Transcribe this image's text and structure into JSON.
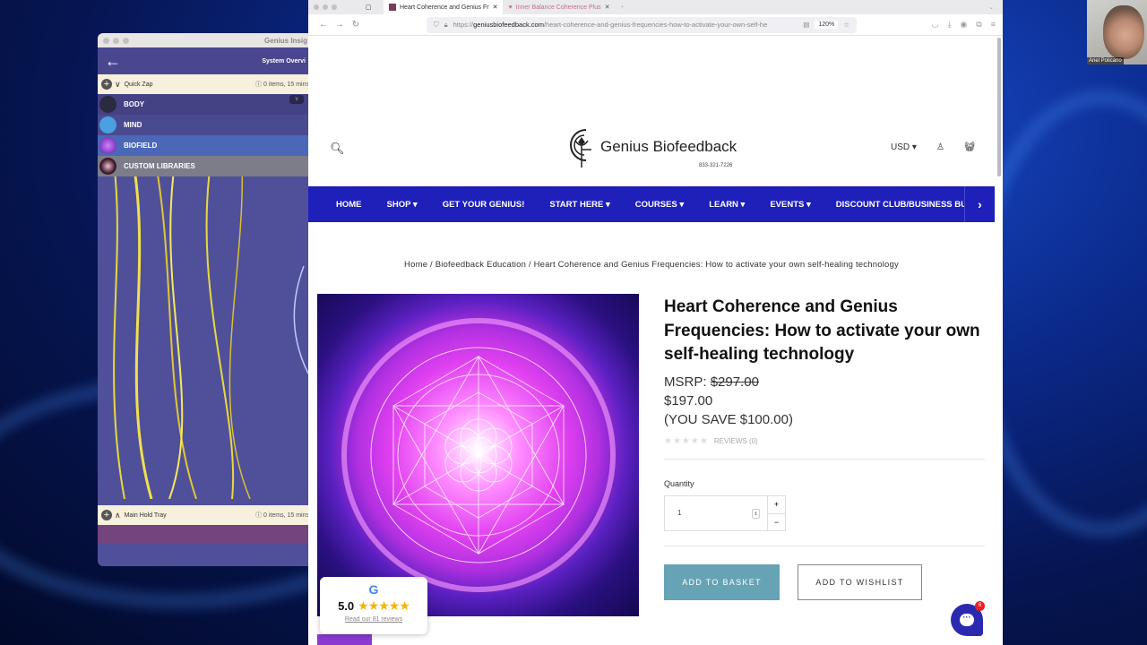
{
  "desktop": {
    "theme_colors": {
      "background": "#0b2a8c"
    }
  },
  "left_app": {
    "window_title": "Genius Insig",
    "back_icon": "back-arrow-icon",
    "header_label": "System Overvi",
    "quick_zap": {
      "label": "Quick Zap",
      "info": "0 items, 15 mins"
    },
    "libraries": [
      {
        "label": "BODY",
        "icon_color": "#2a2a40"
      },
      {
        "label": "MIND",
        "icon_color": "#4aa0e0"
      },
      {
        "label": "BIOFIELD",
        "icon_color": "#7a30c0"
      },
      {
        "label": "CUSTOM LIBRARIES",
        "icon_color": "#3a1a2a"
      }
    ],
    "main_hold_tray": {
      "label": "Main Hold Tray",
      "info": "0 items, 15 mins"
    }
  },
  "browser": {
    "tabs": [
      {
        "title": "Heart Coherence and Genius Fr",
        "active": true
      },
      {
        "title": "Inner Balance Coherence Plus",
        "active": false
      }
    ],
    "url_prefix": "https://",
    "url_domain": "geniusbiofeedback.com",
    "url_path": "/heart-coherence-and-genius-frequencies-how-to-activate-your-own-self-he",
    "zoom_level": "120%"
  },
  "site": {
    "brand_name": "Genius Biofeedback",
    "phone": "833-321-7226",
    "currency": "USD",
    "nav": [
      {
        "label": "HOME",
        "dropdown": false
      },
      {
        "label": "SHOP",
        "dropdown": true
      },
      {
        "label": "GET YOUR GENIUS!",
        "dropdown": false
      },
      {
        "label": "START HERE",
        "dropdown": true
      },
      {
        "label": "COURSES",
        "dropdown": true
      },
      {
        "label": "LEARN",
        "dropdown": true
      },
      {
        "label": "EVENTS",
        "dropdown": true
      },
      {
        "label": "DISCOUNT CLUB/BUSINESS BUI",
        "dropdown": false
      }
    ],
    "nav_color": "#1f1fb9",
    "breadcrumb": "Home / Biofeedback Education / Heart Coherence and Genius Frequencies: How to activate your own self-healing technology",
    "product": {
      "title": "Heart Coherence and Genius Frequencies: How to activate your own self-healing technology",
      "msrp_label": "MSRP:",
      "msrp": "$297.00",
      "price": "$197.00",
      "savings": "(YOU SAVE $100.00)",
      "reviews_label": "REVIEWS (0)",
      "rating_stars": 0,
      "quantity_label": "Quantity",
      "quantity": "1",
      "add_to_basket": "ADD TO BASKET",
      "add_to_wishlist": "ADD TO WISHLIST",
      "basket_color": "#66a3b5"
    },
    "google_reviews": {
      "score": "5.0",
      "stars": 5,
      "link": "Read our 81 reviews"
    },
    "chat_badge": "6"
  },
  "webcam": {
    "name": "Ariel Policano"
  }
}
